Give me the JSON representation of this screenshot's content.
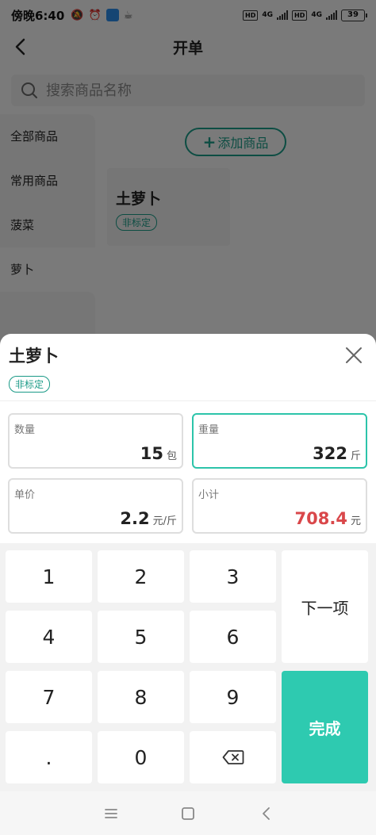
{
  "status_bar": {
    "time": "傍晚6:40",
    "network_1": "4G",
    "network_2": "4G",
    "hd_1": "HD",
    "hd_2": "HD",
    "battery": "39"
  },
  "header": {
    "title": "开单"
  },
  "search": {
    "placeholder": "搜索商品名称"
  },
  "sidebar": {
    "items": [
      {
        "label": "全部商品"
      },
      {
        "label": "常用商品"
      },
      {
        "label": "菠菜"
      },
      {
        "label": "萝卜"
      }
    ]
  },
  "content": {
    "add_button_label": "添加商品",
    "product": {
      "name": "土萝卜",
      "tag": "非标定"
    }
  },
  "sheet": {
    "title": "土萝卜",
    "tag": "非标定",
    "fields": {
      "quantity": {
        "label": "数量",
        "value": "15",
        "unit": "包"
      },
      "weight": {
        "label": "重量",
        "value": "322",
        "unit": "斤"
      },
      "unit_price": {
        "label": "单价",
        "value": "2.2",
        "unit": "元/斤"
      },
      "subtotal": {
        "label": "小计",
        "value": "708.4",
        "unit": "元"
      }
    }
  },
  "keypad": {
    "keys": {
      "k1": "1",
      "k2": "2",
      "k3": "3",
      "k4": "4",
      "k5": "5",
      "k6": "6",
      "k7": "7",
      "k8": "8",
      "k9": "9",
      "kdot": ".",
      "k0": "0"
    },
    "next_label": "下一项",
    "done_label": "完成",
    "backspace_icon": "backspace-icon"
  },
  "colors": {
    "accent": "#2ecab0",
    "accent_dark": "#1a9a87",
    "subtotal_red": "#d9474a"
  }
}
